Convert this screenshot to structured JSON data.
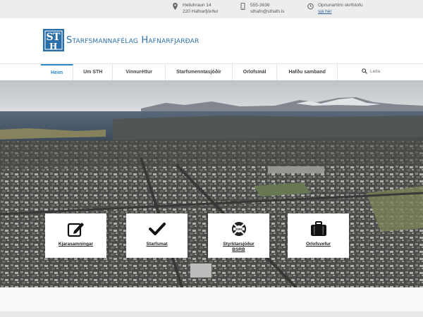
{
  "topbar": {
    "address": {
      "line1": "Helluhraun 14",
      "line2": "220 Hafnarfjörður"
    },
    "contact": {
      "phone": "555-3636",
      "email": "sthafn@sthafn.is"
    },
    "hours": {
      "line1": "Opnunartími skrifstofu",
      "link": "sjá hér"
    }
  },
  "header": {
    "logo_text": "Starfsmannafélag Hafnarfjarðar",
    "logo_initials": "STH"
  },
  "nav": {
    "items": [
      {
        "label": "Heim"
      },
      {
        "label": "Um STH"
      },
      {
        "label": "Vinnuréttur"
      },
      {
        "label": "Starfsmenntasjóðir"
      },
      {
        "label": "Orlofsmál"
      },
      {
        "label": "Hafðu samband"
      }
    ],
    "search_placeholder": "Leita"
  },
  "tiles": [
    {
      "label": "Kjarasamningar",
      "icon": "edit-icon"
    },
    {
      "label": "Starfsmat",
      "icon": "checkmark-icon"
    },
    {
      "label": "Styrktarsjóður BSRB",
      "icon": "lifebuoy-icon"
    },
    {
      "label": "Orlofsvefur",
      "icon": "suitcase-icon"
    }
  ],
  "colors": {
    "accent": "#2b89c8",
    "logo": "#2b6fa8"
  }
}
